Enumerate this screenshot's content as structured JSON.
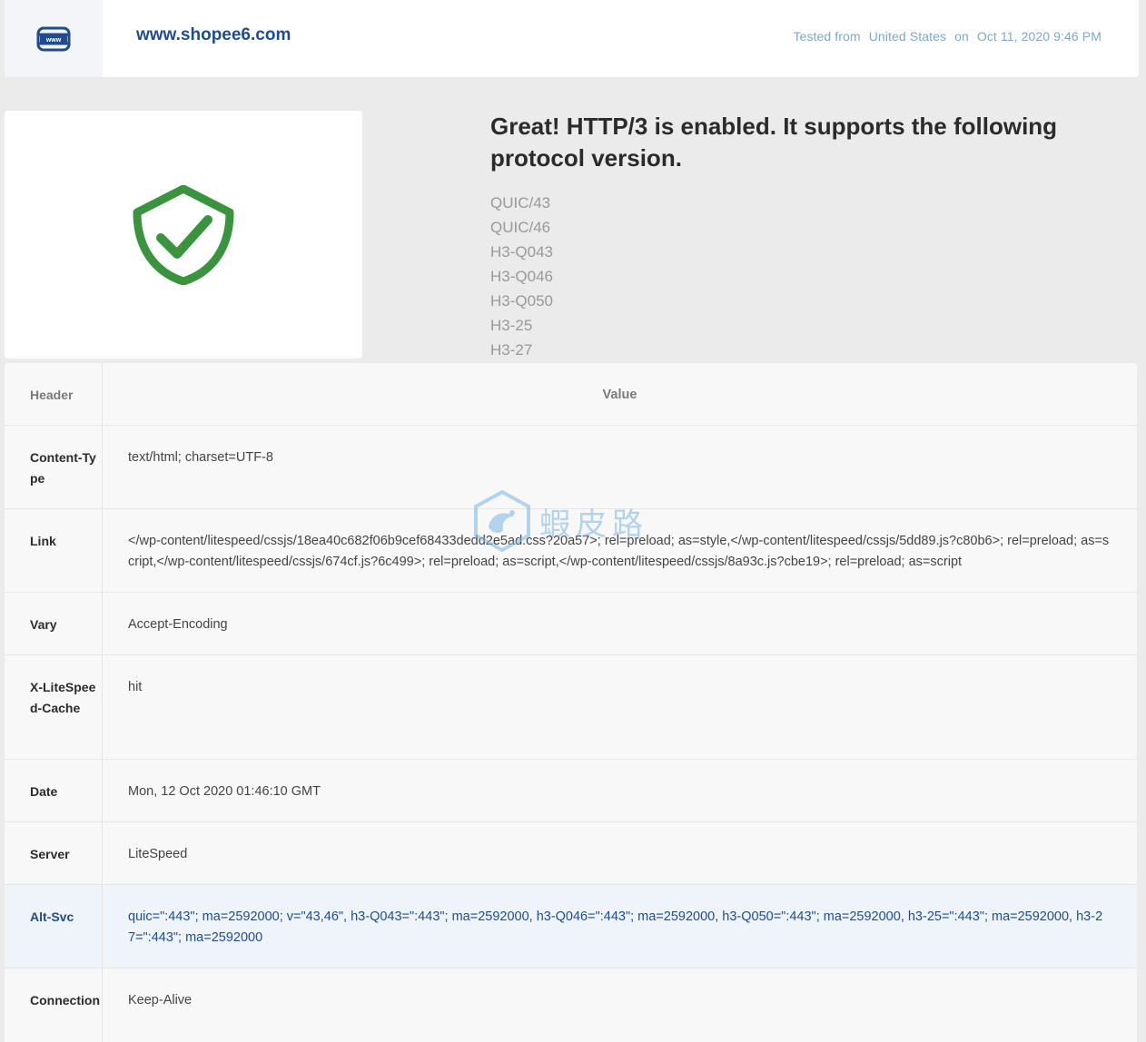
{
  "header": {
    "icon": "www-globe-icon",
    "domain": "www.shopee6.com",
    "tested_prefix": "Tested from",
    "location": "United States",
    "on_word": "on",
    "datetime": "Oct 11, 2020 9:46 PM"
  },
  "result": {
    "icon": "shield-check-icon",
    "status_color": "#3a943e",
    "title": "Great! HTTP/3 is enabled. It supports the following protocol version.",
    "versions": [
      "QUIC/43",
      "QUIC/46",
      "H3-Q043",
      "H3-Q046",
      "H3-Q050",
      "H3-25",
      "H3-27"
    ]
  },
  "table": {
    "col_header": "Header",
    "col_value": "Value",
    "rows": [
      {
        "header": "Content-Type",
        "value": "text/html; charset=UTF-8"
      },
      {
        "header": "Link",
        "value": "</wp-content/litespeed/cssjs/18ea40c682f06b9cef68433dedd2e5ad.css?20a57>; rel=preload; as=style,</wp-content/litespeed/cssjs/5dd89.js?c80b6>; rel=preload; as=script,</wp-content/litespeed/cssjs/674cf.js?6c499>; rel=preload; as=script,</wp-content/litespeed/cssjs/8a93c.js?cbe19>; rel=preload; as=script"
      },
      {
        "header": "Vary",
        "value": "Accept-Encoding"
      },
      {
        "header": "X-LiteSpeed-Cache",
        "value": "hit"
      },
      {
        "header": "Date",
        "value": "Mon, 12 Oct 2020 01:46:10 GMT"
      },
      {
        "header": "Server",
        "value": "LiteSpeed"
      },
      {
        "header": "Alt-Svc",
        "value": "quic=\":443\"; ma=2592000; v=\"43,46\", h3-Q043=\":443\"; ma=2592000, h3-Q046=\":443\"; ma=2592000, h3-Q050=\":443\"; ma=2592000, h3-25=\":443\"; ma=2592000, h3-27=\":443\"; ma=2592000"
      },
      {
        "header": "Connection",
        "value": "Keep-Alive"
      }
    ]
  },
  "watermark": {
    "text": "蝦皮路",
    "icon": "shrimp-logo-icon"
  }
}
